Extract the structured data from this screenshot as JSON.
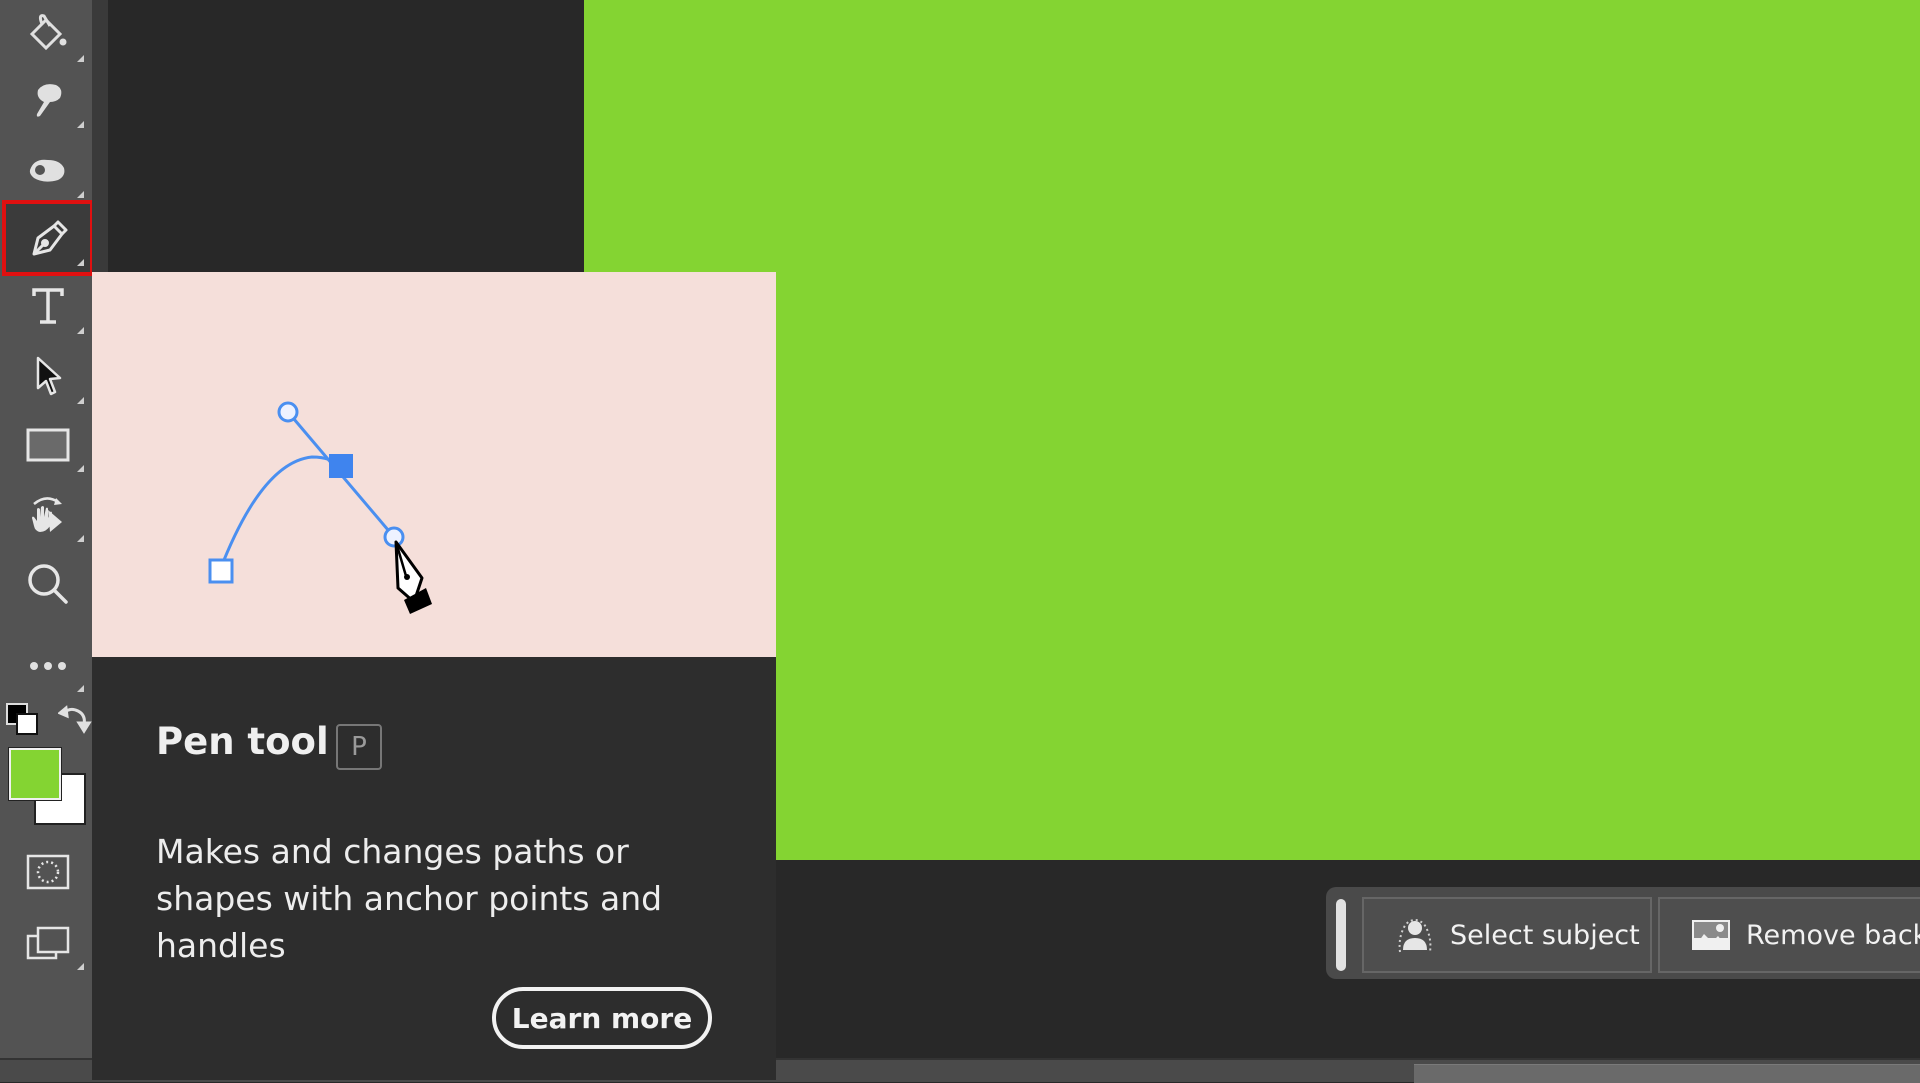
{
  "toolbar": {
    "tools": [
      {
        "name": "Paint Bucket tool",
        "icon": "paint-bucket-icon"
      },
      {
        "name": "Smudge tool",
        "icon": "smudge-icon"
      },
      {
        "name": "Dodge tool",
        "icon": "dodge-icon"
      },
      {
        "name": "Pen tool",
        "icon": "pen-icon",
        "active": true
      },
      {
        "name": "Type tool",
        "icon": "type-icon"
      },
      {
        "name": "Path Selection tool",
        "icon": "arrow-icon"
      },
      {
        "name": "Rectangle tool",
        "icon": "rectangle-icon"
      },
      {
        "name": "Rotate View tool",
        "icon": "rotate-hand-icon"
      },
      {
        "name": "Zoom tool",
        "icon": "zoom-icon"
      },
      {
        "name": "Edit Toolbar",
        "icon": "more-icon"
      },
      {
        "name": "Quick Mask mode",
        "icon": "quick-mask-icon"
      },
      {
        "name": "Change Screen Mode",
        "icon": "screen-mode-icon"
      }
    ],
    "foreground_color": "#84d432",
    "background_color": "#ffffff",
    "highlight_color": "#e01010"
  },
  "canvas": {
    "fill_color": "#84d432"
  },
  "tooltip": {
    "title": "Pen tool",
    "shortcut": "P",
    "description": "Makes and changes paths or shapes with anchor points and handles",
    "learn_more_label": "Learn more",
    "illustration_bg": "#f5dfda",
    "path_color": "#4a8ff0"
  },
  "contextual_taskbar": {
    "buttons": [
      {
        "label": "Select subject",
        "icon": "select-subject-icon"
      },
      {
        "label": "Remove backg",
        "icon": "remove-background-icon"
      }
    ]
  }
}
